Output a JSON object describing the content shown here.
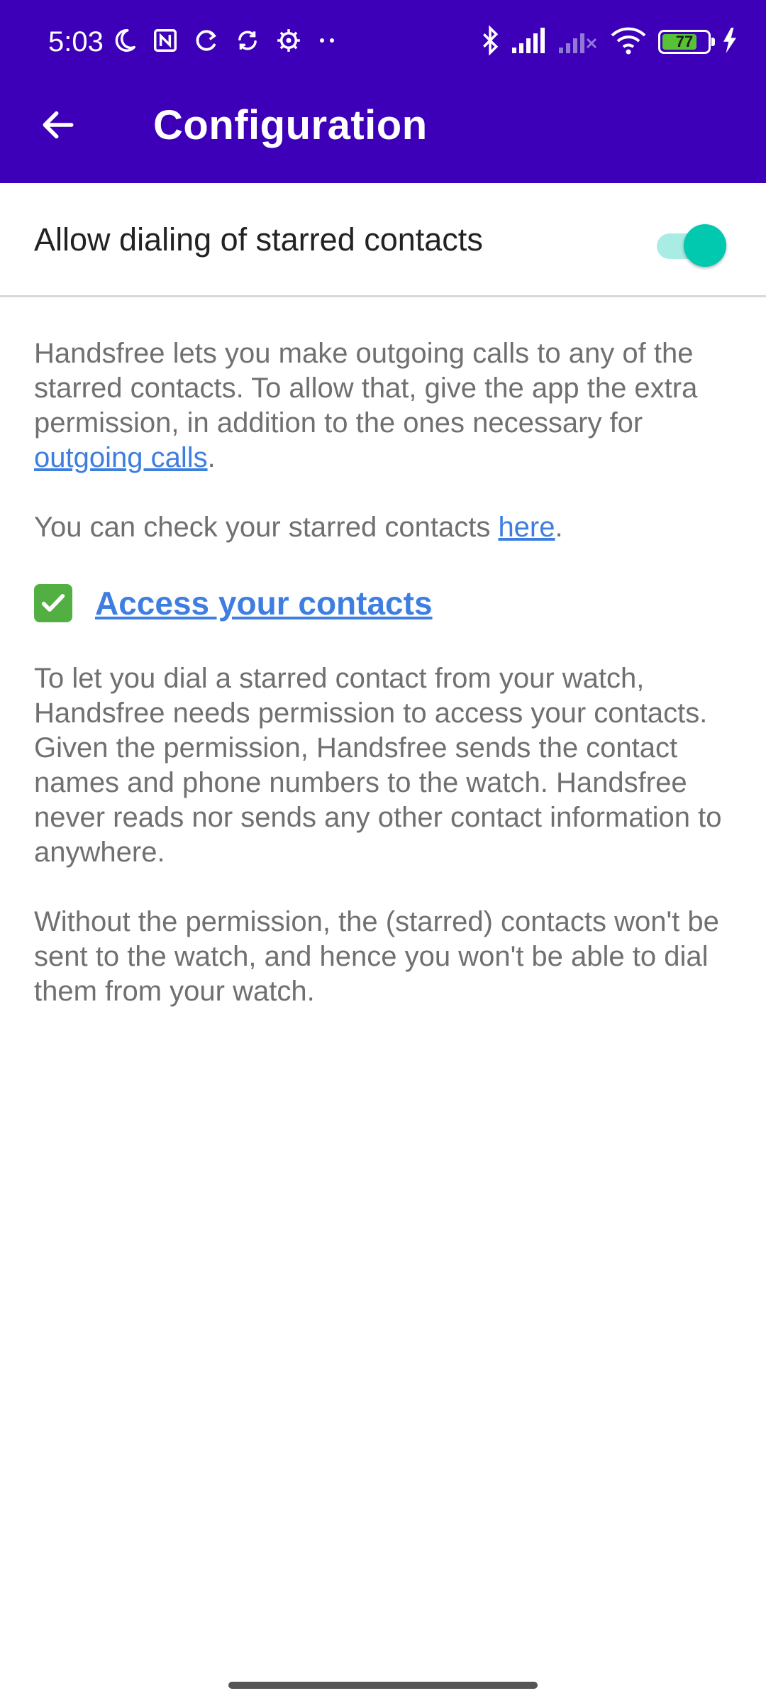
{
  "status_bar": {
    "time": "5:03",
    "battery_level": "77",
    "battery_fraction": 0.77,
    "left_icons": [
      "moon-icon",
      "nfc-icon",
      "sync-icon",
      "sync-alt-icon",
      "settings-gear-icon",
      "more-dots-icon"
    ],
    "right_icons": [
      "bluetooth-icon",
      "signal-icon",
      "signal-off-icon",
      "wifi-icon",
      "battery-icon",
      "charging-icon"
    ]
  },
  "toolbar": {
    "back_icon": "arrow-back-icon",
    "title": "Configuration"
  },
  "setting": {
    "label": "Allow dialing of starred contacts",
    "enabled": true
  },
  "body": {
    "para1_text": "Handsfree lets you make outgoing calls to any of the starred contacts. To allow that, give the app the extra permission, in addition to the ones necessary for ",
    "para1_link": "outgoing calls",
    "para1_end": ".",
    "para2_text": "You can check your starred contacts ",
    "para2_link": "here",
    "para2_end": ".",
    "permission_icon": "check-mark-icon",
    "permission_link": "Access your contacts",
    "para3": "To let you dial a starred contact from your watch, Handsfree needs permission to access your contacts. Given the permission, Handsfree sends the contact names and phone numbers to the watch. Handsfree never reads nor sends any other contact information to anywhere.",
    "para4": "Without the permission, the (starred) contacts won't be sent to the watch, and hence you won't be able to dial them from your watch."
  },
  "colors": {
    "app_bar": "#3d00b8",
    "link": "#3d7ee0",
    "switch_thumb": "#00c9b0",
    "switch_track": "#a8ece3",
    "check_green": "#52b043"
  }
}
